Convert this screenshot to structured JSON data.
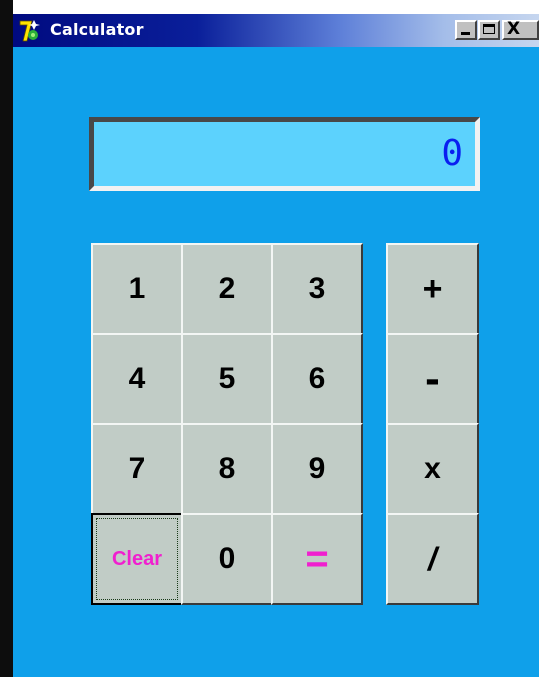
{
  "window": {
    "title": "Calculator",
    "min_glyph": "_",
    "close_glyph": "X"
  },
  "display": {
    "value": "0"
  },
  "keypad": {
    "digits": [
      "1",
      "2",
      "3",
      "4",
      "5",
      "6",
      "7",
      "8",
      "9",
      "0"
    ],
    "clear_label": "Clear",
    "equals_label": "="
  },
  "operators": [
    "+",
    "-",
    "x",
    "/"
  ],
  "colors": {
    "window_background": "#0fa0ea",
    "display_background": "#5cd2fd",
    "display_text": "#0a1ff0",
    "key_face": "#c1ccc6",
    "accent_text": "#f01fcf"
  }
}
